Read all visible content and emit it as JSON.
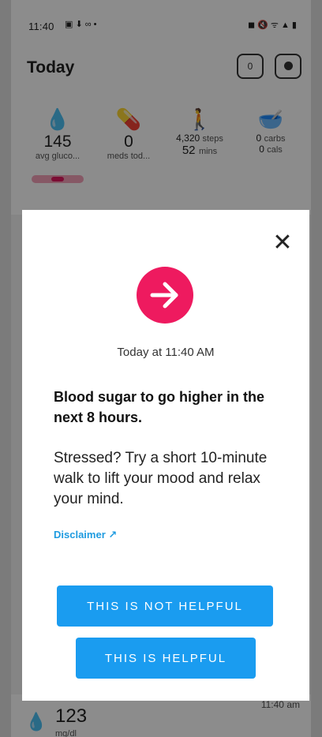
{
  "status_bar": {
    "time": "11:40",
    "left_icons": "▣ ⬇ ∞ •",
    "right_icons": "◼ 🔇 ᯤ ▲ ▮"
  },
  "header": {
    "title": "Today",
    "notification_count": "0"
  },
  "summary": {
    "glucose": {
      "value": "145",
      "label": "avg gluco..."
    },
    "meds": {
      "value": "0",
      "label": "meds tod..."
    },
    "activity": {
      "steps_value": "4,320",
      "steps_unit": "steps",
      "mins_value": "52",
      "mins_unit": "mins"
    },
    "food": {
      "carbs_value": "0",
      "carbs_unit": "carbs",
      "cals_value": "0",
      "cals_unit": "cals"
    }
  },
  "list": {
    "value": "123",
    "unit": "mg/dl",
    "time": "11:40 am"
  },
  "modal": {
    "timestamp": "Today at 11:40 AM",
    "headline": "Blood sugar to go higher in the next 8 hours.",
    "body": "Stressed? Try a short 10-minute walk to lift your mood and relax your mind.",
    "disclaimer": "Disclaimer ↗",
    "not_helpful_label": "THIS IS NOT HELPFUL",
    "helpful_label": "THIS IS HELPFUL"
  },
  "colors": {
    "accent_pink": "#ee1a5f",
    "button_blue": "#1a9cf0",
    "link_blue": "#1e9be0"
  }
}
